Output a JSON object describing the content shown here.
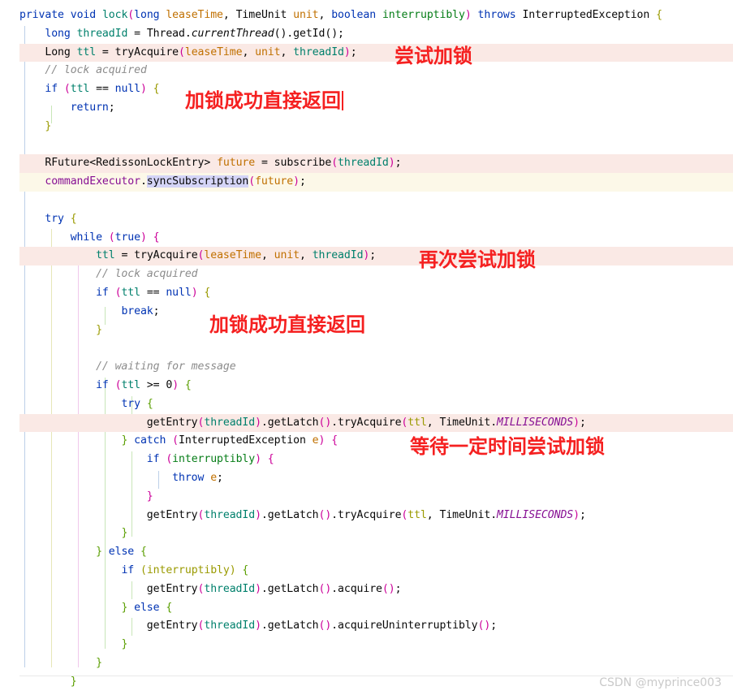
{
  "editor": {
    "language": "java",
    "background_color": "#ffffff",
    "highlight_band_color": "#fae9e5",
    "secondary_band_color": "#fcf8e8",
    "selection_color": "#d4d4f7",
    "annotation_color": "#f52020"
  },
  "code": {
    "lines": [
      "private void lock(long leaseTime, TimeUnit unit, boolean interruptibly) throws InterruptedException {",
      "    long threadId = Thread.currentThread().getId();",
      "    Long ttl = tryAcquire(leaseTime, unit, threadId);",
      "    // lock acquired",
      "    if (ttl == null) {",
      "        return;",
      "    }",
      "",
      "    RFuture<RedissonLockEntry> future = subscribe(threadId);",
      "    commandExecutor.syncSubscription(future);",
      "",
      "    try {",
      "        while (true) {",
      "            ttl = tryAcquire(leaseTime, unit, threadId);",
      "            // lock acquired",
      "            if (ttl == null) {",
      "                break;",
      "            }",
      "",
      "            // waiting for message",
      "            if (ttl >= 0) {",
      "                try {",
      "                    getEntry(threadId).getLatch().tryAcquire(ttl, TimeUnit.MILLISECONDS);",
      "                } catch (InterruptedException e) {",
      "                    if (interruptibly) {",
      "                        throw e;",
      "                    }",
      "                    getEntry(threadId).getLatch().tryAcquire(ttl, TimeUnit.MILLISECONDS);",
      "                }",
      "            } else {",
      "                if (interruptibly) {",
      "                    getEntry(threadId).getLatch().acquire();",
      "                } else {",
      "                    getEntry(threadId).getLatch().acquireUninterruptibly();",
      "                }",
      "            }",
      "        }"
    ],
    "highlighted_lines": [
      "Long ttl = tryAcquire(leaseTime, unit, threadId);",
      "RFuture<RedissonLockEntry> future = subscribe(threadId);",
      "ttl = tryAcquire(leaseTime, unit, threadId);",
      "getEntry(threadId).getLatch().tryAcquire(ttl, TimeUnit.MILLISECONDS);"
    ],
    "selected_text": "syncSubscription"
  },
  "annotations": [
    {
      "id": "anno-try-acquire",
      "text": "尝试加锁",
      "has_caret": false
    },
    {
      "id": "anno-return-on-success",
      "text": "加锁成功直接返回",
      "has_caret": true
    },
    {
      "id": "anno-retry-acquire",
      "text": "再次尝试加锁",
      "has_caret": false
    },
    {
      "id": "anno-break-on-success",
      "text": "加锁成功直接返回",
      "has_caret": false
    },
    {
      "id": "anno-wait-then-acquire",
      "text": "等待一定时间尝试加锁",
      "has_caret": false
    }
  ],
  "watermark": {
    "text": "CSDN @myprince003"
  }
}
